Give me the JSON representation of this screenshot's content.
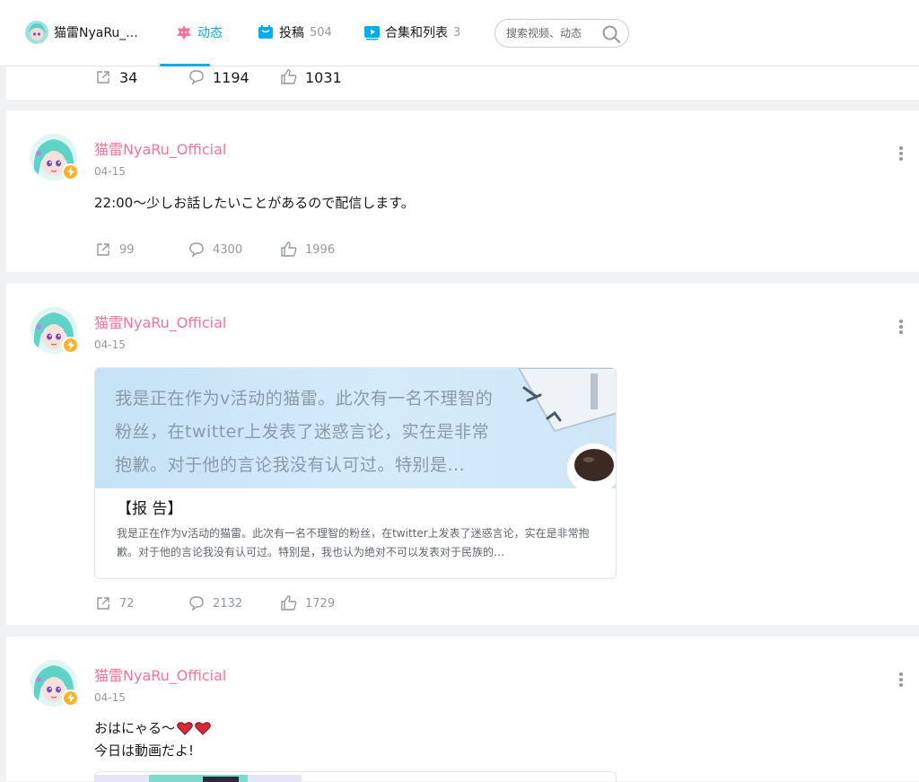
{
  "nav": {
    "username": "猫雷NyaRu_...",
    "tabs": [
      {
        "label": "动态",
        "count": ""
      },
      {
        "label": "投稿",
        "count": "504"
      },
      {
        "label": "合集和列表",
        "count": "3"
      }
    ],
    "search_placeholder": "搜索视频、动态"
  },
  "colors": {
    "accent": "#00aeec",
    "author": "#fb7299",
    "text_muted": "#9499a0"
  },
  "top_partial": {
    "stats": {
      "share": "34",
      "comment": "1194",
      "like": "1031"
    }
  },
  "posts": [
    {
      "author": "猫雷NyaRu_Official",
      "date": "04-15",
      "text": "22:00～少しお話したいことがあるので配信します。",
      "stats": {
        "share": "99",
        "comment": "4300",
        "like": "1996"
      }
    },
    {
      "author": "猫雷NyaRu_Official",
      "date": "04-15",
      "article": {
        "cover_text": "我是正在作为v活动的猫雷。此次有一名不理智的粉丝，在twitter上发表了迷惑言论，实在是非常抱歉。对于他的言论我没有认可过。特别是...",
        "title": "【报 告】",
        "desc": "我是正在作为v活动的猫雷。此次有一名不理智的粉丝，在twitter上发表了迷惑言论，实在是非常抱歉。对于他的言论我没有认可过。特别是，我也认为绝对不可以发表对于民族的…"
      },
      "stats": {
        "share": "72",
        "comment": "2132",
        "like": "1729"
      }
    },
    {
      "author": "猫雷NyaRu_Official",
      "date": "04-15",
      "line1": "おはにゃる～",
      "line2": "今日は動画だよ!"
    }
  ]
}
